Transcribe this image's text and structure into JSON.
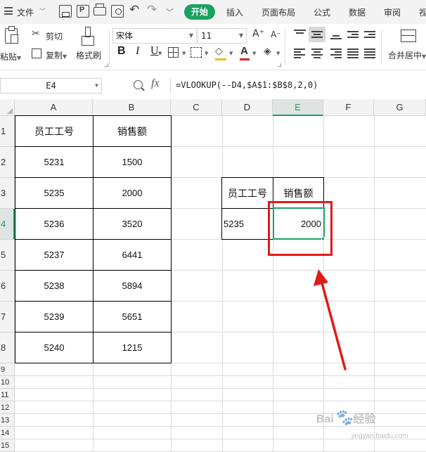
{
  "menubar": {
    "file": "文件",
    "tabs": [
      "开始",
      "插入",
      "页面布局",
      "公式",
      "数据",
      "审阅",
      "视"
    ]
  },
  "ribbon": {
    "paste": "粘贴",
    "cut": "剪切",
    "copy": "复制",
    "format_painter": "格式刷",
    "font_name": "宋体",
    "font_size": "11",
    "bold": "B",
    "italic": "I",
    "underline": "U",
    "font_color": "A",
    "merge_center": "合并居中"
  },
  "formula_bar": {
    "name_box": "E4",
    "fx": "fx",
    "formula": "=VLOOKUP(--D4,$A$1:$B$8,2,0)"
  },
  "sheet": {
    "columns": [
      "A",
      "B",
      "C",
      "D",
      "E",
      "F",
      "G"
    ],
    "rows": [
      "1",
      "2",
      "3",
      "4",
      "5",
      "6",
      "7",
      "8",
      "9",
      "10",
      "11",
      "12",
      "13",
      "14",
      "15"
    ],
    "selected_cell": "E4",
    "table_left": {
      "headers": [
        "员工工号",
        "销售额"
      ],
      "rows": [
        [
          "5231",
          "1500"
        ],
        [
          "5235",
          "2000"
        ],
        [
          "5236",
          "3520"
        ],
        [
          "5237",
          "6441"
        ],
        [
          "5238",
          "5894"
        ],
        [
          "5239",
          "5651"
        ],
        [
          "5240",
          "1215"
        ]
      ]
    },
    "table_right": {
      "headers": [
        "员工工号",
        "销售额"
      ],
      "row": [
        "5235",
        "2000"
      ]
    }
  },
  "colors": {
    "accent_green": "#1aa260",
    "annotation_red": "#e21a1a"
  },
  "watermark": {
    "text": "Bai",
    "suffix": "经验",
    "sub": "jingyan.baidu.com"
  }
}
